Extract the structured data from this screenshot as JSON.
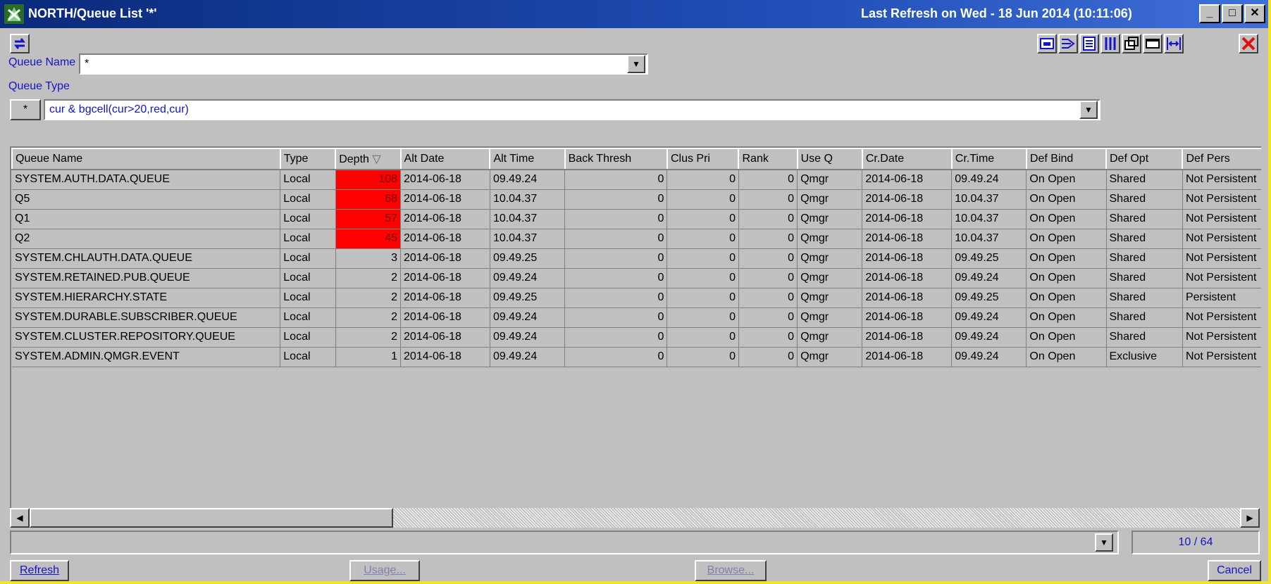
{
  "window": {
    "title": "NORTH/Queue List '*'",
    "last_refresh": "Last Refresh on Wed - 18 Jun 2014 (10:11:06)",
    "minimize": "_",
    "maximize": "□",
    "close": "✕"
  },
  "filters": {
    "queue_name_label": "Queue Name",
    "queue_name_value": "*",
    "queue_type_label": "Queue Type",
    "queue_type_button": "*",
    "expression": "cur & bgcell(cur>20,red,cur)"
  },
  "table": {
    "columns": [
      "Queue Name",
      "Type",
      "Depth",
      "Alt Date",
      "Alt Time",
      "Back Thresh",
      "Clus Pri",
      "Rank",
      "Use Q",
      "Cr.Date",
      "Cr.Time",
      "Def Bind",
      "Def Opt",
      "Def Pers"
    ],
    "sort_indicator": "▽",
    "rows": [
      {
        "name": "SYSTEM.AUTH.DATA.QUEUE",
        "type": "Local",
        "depth": "108",
        "alt_date": "2014-06-18",
        "alt_time": "09.49.24",
        "back_thresh": "0",
        "clus_pri": "0",
        "rank": "0",
        "use_q": "Qmgr",
        "cr_date": "2014-06-18",
        "cr_time": "09.49.24",
        "def_bind": "On Open",
        "def_opt": "Shared",
        "def_pers": "Not Persistent"
      },
      {
        "name": "Q5",
        "type": "Local",
        "depth": "68",
        "alt_date": "2014-06-18",
        "alt_time": "10.04.37",
        "back_thresh": "0",
        "clus_pri": "0",
        "rank": "0",
        "use_q": "Qmgr",
        "cr_date": "2014-06-18",
        "cr_time": "10.04.37",
        "def_bind": "On Open",
        "def_opt": "Shared",
        "def_pers": "Not Persistent"
      },
      {
        "name": "Q1",
        "type": "Local",
        "depth": "57",
        "alt_date": "2014-06-18",
        "alt_time": "10.04.37",
        "back_thresh": "0",
        "clus_pri": "0",
        "rank": "0",
        "use_q": "Qmgr",
        "cr_date": "2014-06-18",
        "cr_time": "10.04.37",
        "def_bind": "On Open",
        "def_opt": "Shared",
        "def_pers": "Not Persistent"
      },
      {
        "name": "Q2",
        "type": "Local",
        "depth": "45",
        "alt_date": "2014-06-18",
        "alt_time": "10.04.37",
        "back_thresh": "0",
        "clus_pri": "0",
        "rank": "0",
        "use_q": "Qmgr",
        "cr_date": "2014-06-18",
        "cr_time": "10.04.37",
        "def_bind": "On Open",
        "def_opt": "Shared",
        "def_pers": "Not Persistent"
      },
      {
        "name": "SYSTEM.CHLAUTH.DATA.QUEUE",
        "type": "Local",
        "depth": "3",
        "alt_date": "2014-06-18",
        "alt_time": "09.49.25",
        "back_thresh": "0",
        "clus_pri": "0",
        "rank": "0",
        "use_q": "Qmgr",
        "cr_date": "2014-06-18",
        "cr_time": "09.49.25",
        "def_bind": "On Open",
        "def_opt": "Shared",
        "def_pers": "Not Persistent"
      },
      {
        "name": "SYSTEM.RETAINED.PUB.QUEUE",
        "type": "Local",
        "depth": "2",
        "alt_date": "2014-06-18",
        "alt_time": "09.49.24",
        "back_thresh": "0",
        "clus_pri": "0",
        "rank": "0",
        "use_q": "Qmgr",
        "cr_date": "2014-06-18",
        "cr_time": "09.49.24",
        "def_bind": "On Open",
        "def_opt": "Shared",
        "def_pers": "Not Persistent"
      },
      {
        "name": "SYSTEM.HIERARCHY.STATE",
        "type": "Local",
        "depth": "2",
        "alt_date": "2014-06-18",
        "alt_time": "09.49.25",
        "back_thresh": "0",
        "clus_pri": "0",
        "rank": "0",
        "use_q": "Qmgr",
        "cr_date": "2014-06-18",
        "cr_time": "09.49.25",
        "def_bind": "On Open",
        "def_opt": "Shared",
        "def_pers": "Persistent"
      },
      {
        "name": "SYSTEM.DURABLE.SUBSCRIBER.QUEUE",
        "type": "Local",
        "depth": "2",
        "alt_date": "2014-06-18",
        "alt_time": "09.49.24",
        "back_thresh": "0",
        "clus_pri": "0",
        "rank": "0",
        "use_q": "Qmgr",
        "cr_date": "2014-06-18",
        "cr_time": "09.49.24",
        "def_bind": "On Open",
        "def_opt": "Shared",
        "def_pers": "Not Persistent"
      },
      {
        "name": "SYSTEM.CLUSTER.REPOSITORY.QUEUE",
        "type": "Local",
        "depth": "2",
        "alt_date": "2014-06-18",
        "alt_time": "09.49.24",
        "back_thresh": "0",
        "clus_pri": "0",
        "rank": "0",
        "use_q": "Qmgr",
        "cr_date": "2014-06-18",
        "cr_time": "09.49.24",
        "def_bind": "On Open",
        "def_opt": "Shared",
        "def_pers": "Not Persistent"
      },
      {
        "name": "SYSTEM.ADMIN.QMGR.EVENT",
        "type": "Local",
        "depth": "1",
        "alt_date": "2014-06-18",
        "alt_time": "09.49.24",
        "back_thresh": "0",
        "clus_pri": "0",
        "rank": "0",
        "use_q": "Qmgr",
        "cr_date": "2014-06-18",
        "cr_time": "09.49.24",
        "def_bind": "On Open",
        "def_opt": "Exclusive",
        "def_pers": "Not Persistent"
      }
    ]
  },
  "highlight_color": "#ff0000",
  "status": {
    "count": "10 / 64"
  },
  "buttons": {
    "refresh": "Refresh",
    "usage": "Usage...",
    "browse": "Browse...",
    "cancel": "Cancel"
  }
}
